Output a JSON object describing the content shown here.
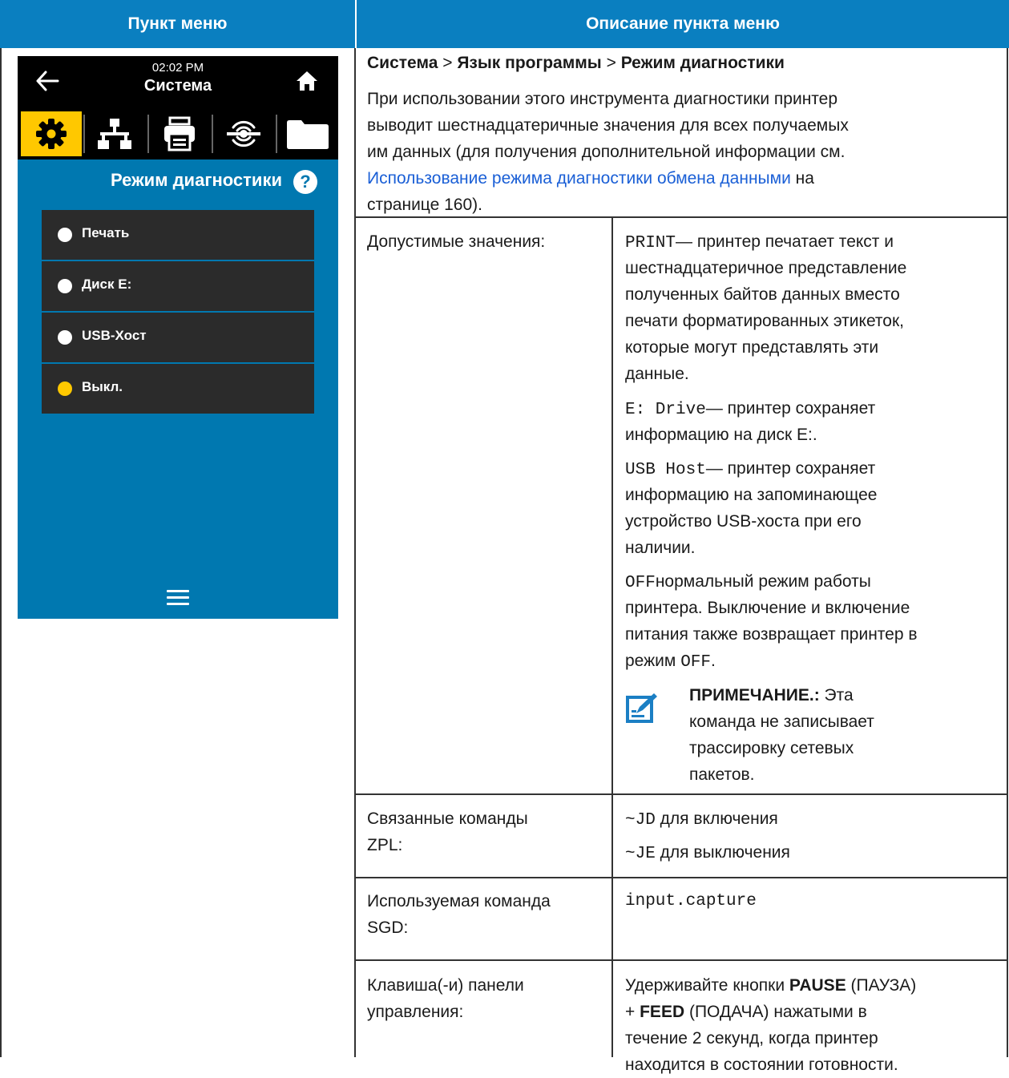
{
  "header": {
    "left": "Пункт меню",
    "right": "Описание пункта меню"
  },
  "device": {
    "time": "02:02 PM",
    "title": "Система",
    "mode_title": "Режим диагностики",
    "help": "?",
    "options": [
      {
        "label": "Печать",
        "selected": false
      },
      {
        "label": "Диск E:",
        "selected": false
      },
      {
        "label": "USB-Хост",
        "selected": false
      },
      {
        "label": "Выкл.",
        "selected": true
      }
    ],
    "icons": [
      "back-arrow-icon",
      "home-icon",
      "gear-icon",
      "network-icon",
      "printer-icon",
      "rfid-icon",
      "folder-icon",
      "menu-icon"
    ],
    "colors": {
      "accent": "#ffc800",
      "screen": "#0078b0",
      "header": "#0a7fc0"
    }
  },
  "description": {
    "path": {
      "a": "Система",
      "sep1": " > ",
      "b": "Язык программы",
      "sep2": " > ",
      "c": "Режим диагностики"
    },
    "intro": {
      "line1": "При использовании этого инструмента диагностики принтер",
      "line2": "выводит шестнадцатеричные значения для всех получаемых",
      "line3": "им данных (для получения дополнительной информации см.",
      "link": "Использование режима диагностики обмена данными",
      "after_link": " на",
      "line5": "странице 160)."
    }
  },
  "rows": {
    "accepted": {
      "label": "Допустимые значения:",
      "print": {
        "code": "PRINT",
        "l1": "— принтер печатает текст и",
        "l2": "шестнадцатеричное представление",
        "l3": "полученных байтов данных вместо",
        "l4": "печати форматированных этикеток,",
        "l5": "которые могут представлять эти",
        "l6": "данные."
      },
      "edrive": {
        "code": "E: Drive",
        "l1": "— принтер сохраняет",
        "l2": "информацию на диск E:."
      },
      "usb": {
        "code": "USB Host",
        "l1": "— принтер сохраняет",
        "l2": "информацию на запоминающее",
        "l3": "устройство USB-хоста при его",
        "l4": "наличии."
      },
      "off": {
        "code": "OFF",
        "l1": "нормальный режим работы",
        "l2": "принтера. Выключение и включение",
        "l3": "питания также возвращает принтер в",
        "l4_pre": "режим ",
        "l4_code": "OFF",
        "l4_post": "."
      },
      "note": {
        "label": "ПРИМЕЧАНИЕ.:",
        "l1": " Эта",
        "l2": "команда не записывает",
        "l3": "трассировку сетевых",
        "l4": "пакетов."
      }
    },
    "zpl": {
      "label_l1": "Связанные команды",
      "label_l2": "ZPL:",
      "cmd1_code": "~JD",
      "cmd1_text": " для включения",
      "cmd2_code": "~JE",
      "cmd2_text": " для выключения"
    },
    "sgd": {
      "label_l1": "Используемая команда",
      "label_l2": "SGD:",
      "value": "input.capture"
    },
    "keys": {
      "label_l1": "Клавиша(-и) панели",
      "label_l2": "управления:",
      "l1_pre": "Удерживайте кнопки ",
      "l1_b": "PAUSE",
      "l1_post": " (ПАУЗА)",
      "l2_pre": "+ ",
      "l2_b": "FEED",
      "l2_post": " (ПОДАЧА) нажатыми в",
      "l3": "течение 2 секунд, когда принтер",
      "l4": "находится в состоянии готовности."
    }
  }
}
